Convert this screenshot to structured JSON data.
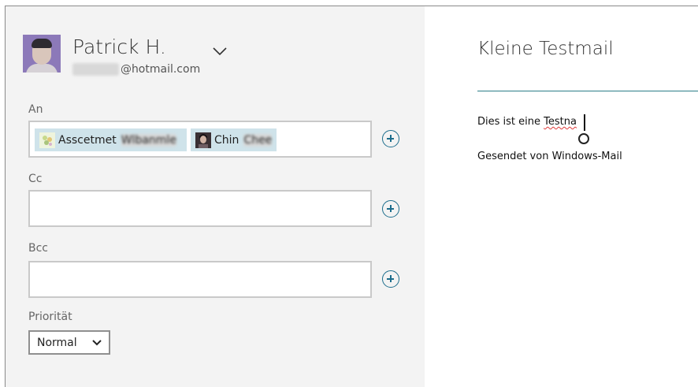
{
  "account": {
    "name": "Patrick H.",
    "email_user_hidden": "interuno",
    "email_domain": "@hotmail.com"
  },
  "fields": {
    "to_label": "An",
    "cc_label": "Cc",
    "bcc_label": "Bcc",
    "to_recipients": [
      {
        "name": "Asscetmet",
        "hidden": "Wlbanmle",
        "icon": "flower-avatar"
      },
      {
        "name": "Chin",
        "hidden": "Chee",
        "icon": "person-avatar"
      }
    ],
    "cc_value": "",
    "bcc_value": ""
  },
  "priority": {
    "label": "Priorität",
    "selected": "Normal"
  },
  "message": {
    "subject": "Kleine Testmail",
    "body_prefix": "Dies ist eine ",
    "body_misspelled": "Testna",
    "signature": "Gesendet von Windows-Mail"
  },
  "colors": {
    "left_pane": "#f3f3f3",
    "accent": "#1c6d8c",
    "chip": "#cfe3ea",
    "subject_rule": "#2b7d88"
  }
}
